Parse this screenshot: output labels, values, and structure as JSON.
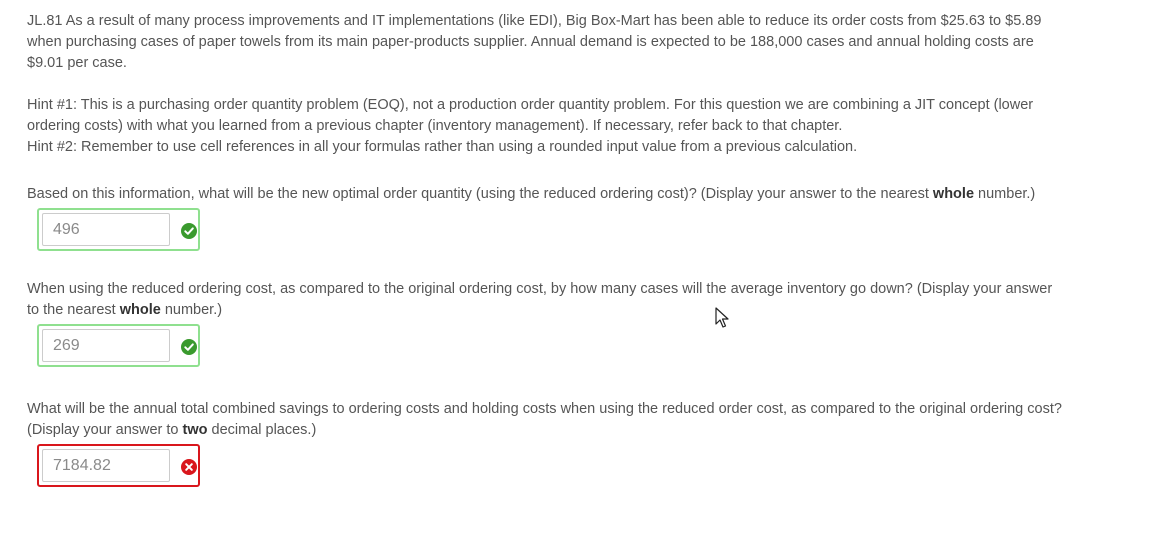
{
  "question": {
    "intro": "JL.81  As a result of many process improvements and IT implementations (like EDI), Big Box-Mart has been able to reduce its order costs from $25.63 to $5.89 when purchasing cases of paper towels from its main paper-products supplier. Annual demand is expected to be 188,000 cases and annual holding costs are $9.01 per case.",
    "hint1": "Hint #1: This is a purchasing order quantity problem (EOQ), not a production order quantity problem. For this question we are combining a JIT concept (lower ordering costs) with what you learned from a previous chapter (inventory management).  If necessary, refer back to that chapter.",
    "hint2": "Hint #2: Remember to use cell references in all your formulas rather than using a rounded input value from a previous calculation."
  },
  "parts": [
    {
      "prompt_before": "Based on this information, what will be the new optimal order quantity (using the reduced ordering cost)? (Display your answer to the nearest ",
      "prompt_bold": "whole",
      "prompt_after": " number.)",
      "answer": "496",
      "status": "correct",
      "status_icon": "check-circle-icon"
    },
    {
      "prompt_before": "When using the reduced ordering cost, as compared to the original ordering cost, by how many cases will the average inventory go down? (Display your answer to the nearest ",
      "prompt_bold": "whole",
      "prompt_after": " number.)",
      "answer": "269",
      "status": "correct",
      "status_icon": "check-circle-icon"
    },
    {
      "prompt_before": "What will be the annual total combined savings to ordering costs and holding costs when using the reduced order cost, as compared to the original ordering cost? (Display your answer to ",
      "prompt_bold": "two",
      "prompt_after": " decimal places.)",
      "answer": "7184.82",
      "status": "incorrect",
      "status_icon": "x-circle-icon"
    }
  ],
  "colors": {
    "text": "#555555",
    "correct_border": "#8fe08f",
    "correct_icon": "#3a9a2e",
    "incorrect_border": "#d9161c",
    "incorrect_icon": "#d9161c"
  }
}
